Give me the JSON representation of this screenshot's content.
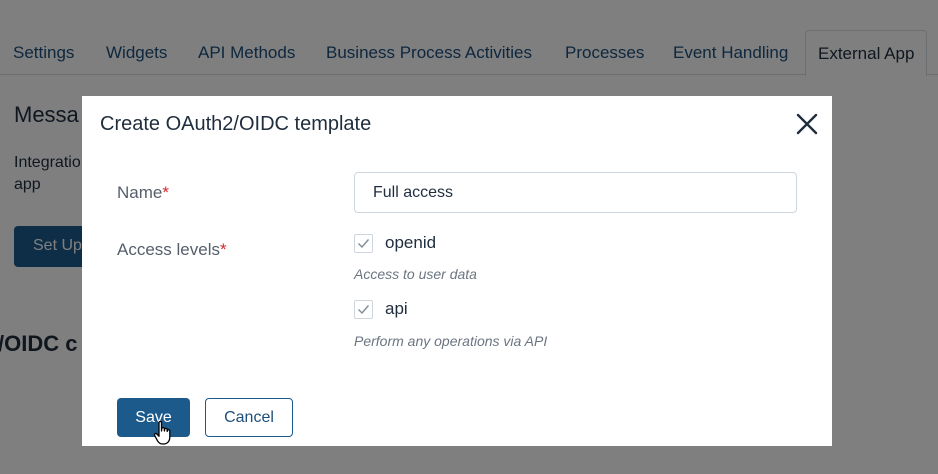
{
  "tabs": [
    {
      "label": "Settings"
    },
    {
      "label": "Widgets"
    },
    {
      "label": "API Methods"
    },
    {
      "label": "Business Process Activities"
    },
    {
      "label": "Processes"
    },
    {
      "label": "Event Handling"
    },
    {
      "label": "External App"
    }
  ],
  "background": {
    "heading": "Messa",
    "text": "Integratio app",
    "button_label": "Set Up",
    "heading2": "/OIDC c"
  },
  "modal": {
    "title": "Create OAuth2/OIDC template",
    "close_icon": "close-icon",
    "name_label": "Name",
    "required_mark": "*",
    "name_value": "Full access",
    "access_label": "Access levels",
    "scopes": [
      {
        "label": "openid",
        "checked": true,
        "hint": "Access to user data"
      },
      {
        "label": "api",
        "checked": true,
        "hint": "Perform any operations via API"
      }
    ],
    "save_label": "Save",
    "cancel_label": "Cancel"
  },
  "colors": {
    "primary": "#1d5a8c",
    "required": "#d8252d",
    "overlay": "rgba(0,0,0,0.5)"
  }
}
